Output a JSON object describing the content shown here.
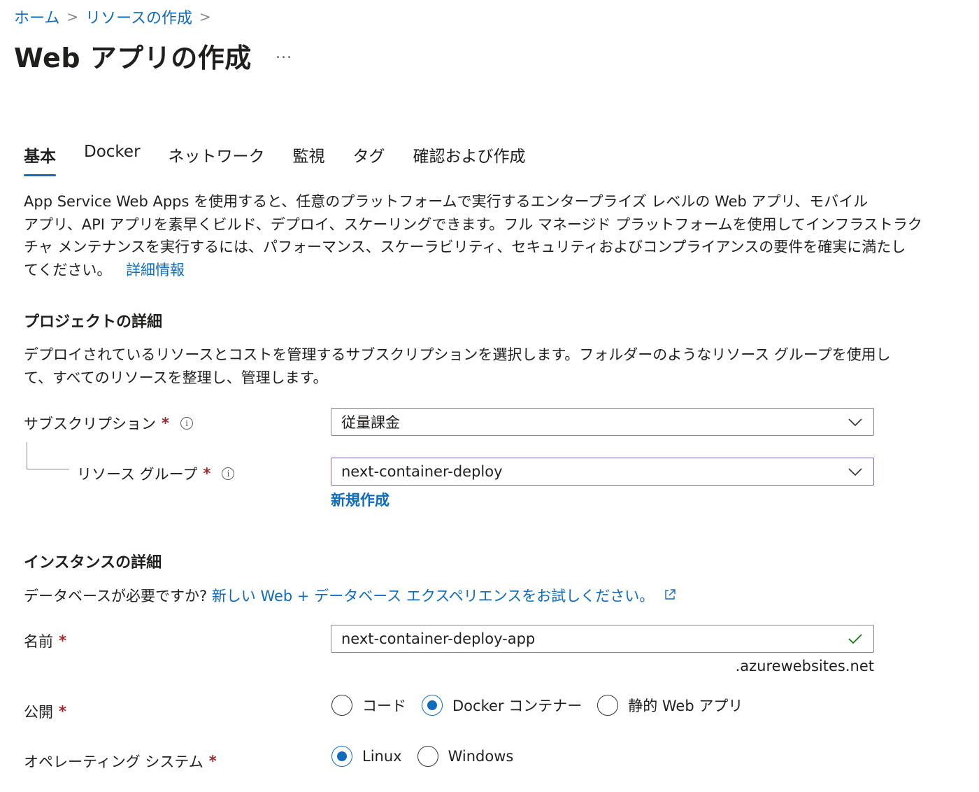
{
  "breadcrumb": {
    "home": "ホーム",
    "create_resource": "リソースの作成",
    "separator": ">"
  },
  "page": {
    "title": "Web アプリの作成",
    "more": "..."
  },
  "tabs": [
    {
      "label": "基本",
      "active": true
    },
    {
      "label": "Docker"
    },
    {
      "label": "ネットワーク"
    },
    {
      "label": "監視"
    },
    {
      "label": "タグ"
    },
    {
      "label": "確認および作成"
    }
  ],
  "intro": {
    "line1": "App Service Web Apps を使用すると、任意のプラットフォームで実行するエンタープライズ レベルの Web アプリ、モバイル",
    "line2": "アプリ、API アプリを素早くビルド、デプロイ、スケーリングできます。フル マネージド プラットフォームを使用してインフラストラク",
    "line3": "チャ メンテナンスを実行するには、パフォーマンス、スケーラビリティ、セキュリティおよびコンプライアンスの要件を確実に満たし",
    "line4": "てください。",
    "learn_more": "詳細情報"
  },
  "project": {
    "heading": "プロジェクトの詳細",
    "desc_line1": "デプロイされているリソースとコストを管理するサブスクリプションを選択します。フォルダーのようなリソース グループを使用し",
    "desc_line2": "て、すべてのリソースを整理し、管理します。",
    "subscription": {
      "label": "サブスクリプション",
      "required": "*",
      "value": "従量課金"
    },
    "resource_group": {
      "label": "リソース グループ",
      "required": "*",
      "value": "next-container-deploy",
      "create_new": "新規作成"
    }
  },
  "instance": {
    "heading": "インスタンスの詳細",
    "db_question": "データベースが必要ですか?",
    "db_link": "新しい Web + データベース エクスペリエンスをお試しください。",
    "name": {
      "label": "名前",
      "required": "*",
      "value": "next-container-deploy-app",
      "suffix": ".azurewebsites.net"
    },
    "publish": {
      "label": "公開",
      "required": "*",
      "options": [
        {
          "label": "コード",
          "checked": false
        },
        {
          "label": "Docker コンテナー",
          "checked": true
        },
        {
          "label": "静的 Web アプリ",
          "checked": false
        }
      ]
    },
    "os": {
      "label": "オペレーティング システム",
      "required": "*",
      "options": [
        {
          "label": "Linux",
          "checked": true
        },
        {
          "label": "Windows",
          "checked": false
        }
      ]
    }
  },
  "icons": {
    "info": "info-icon",
    "chevron": "chevron-down-icon",
    "check": "checkmark-icon",
    "external": "external-link-icon"
  },
  "colors": {
    "link": "#0f6cbd",
    "required": "#a4262c",
    "focus_border": "#8764b8",
    "valid_check": "#107c10"
  }
}
